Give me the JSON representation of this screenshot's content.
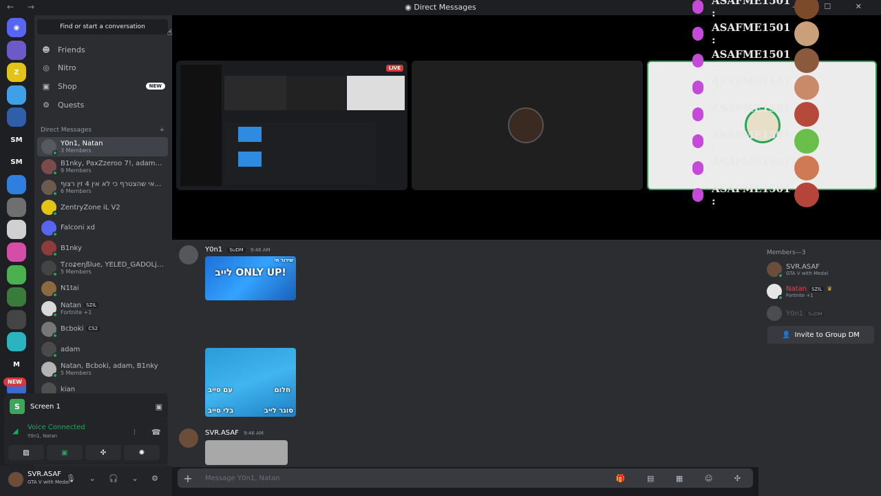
{
  "window": {
    "title": "Direct Messages",
    "nav": "← →",
    "controls": "— ☐ ✕"
  },
  "search": {
    "placeholder": "Find or start a conversation"
  },
  "nav_items": [
    {
      "label": "Friends",
      "icon": "friends-icon",
      "glyph": "☻"
    },
    {
      "label": "Nitro",
      "icon": "nitro-icon",
      "glyph": "◎"
    },
    {
      "label": "Shop",
      "icon": "shop-icon",
      "glyph": "▣",
      "badge": "NEW"
    },
    {
      "label": "Quests",
      "icon": "quests-icon",
      "glyph": "⚙"
    }
  ],
  "dm_header": {
    "label": "Direct Messages",
    "add": "+"
  },
  "dms": [
    {
      "name": "Y0n1, Natan",
      "sub": "3 Members",
      "selected": true,
      "color": "#56595f"
    },
    {
      "name": "B1nky, PaxZzeroo 7!, adam, Bcb...",
      "sub": "9 Members",
      "color": "#7a4b4b"
    },
    {
      "name": "וניתאי שהצטרף כי לא אין 4 זין רצוף",
      "sub": "6 Members",
      "color": "#6b5a4e"
    },
    {
      "name": "ZentryZone iL V2",
      "sub": "",
      "color": "#e3c416"
    },
    {
      "name": "Falconi xd",
      "sub": "",
      "color": "#5865f2"
    },
    {
      "name": "B1nky",
      "sub": "",
      "color": "#8e3b3b"
    },
    {
      "name": "Ƭɾօʑҽɳßlue, YELED_GADOLjr, it...",
      "sub": "5 Members",
      "color": "#444"
    },
    {
      "name": "N1tai",
      "sub": "",
      "color": "#8a6a3e"
    },
    {
      "name": "Natan",
      "sub": "Fortnite +1",
      "tag": "SZIL",
      "color": "#d9d9d9"
    },
    {
      "name": "Bcboki",
      "sub": "",
      "tag": "CS2",
      "color": "#777"
    },
    {
      "name": "adam",
      "sub": "",
      "color": "#4a4a4a"
    },
    {
      "name": "Natan, Bcboki, adam, B1nky",
      "sub": "5 Members",
      "color": "#b3b3b3"
    },
    {
      "name": "kian",
      "sub": "",
      "color": "#4f4f4f"
    }
  ],
  "servers": [
    {
      "label": "◉",
      "color": "#5865f2"
    },
    {
      "label": "",
      "color": "#6d5ac9"
    },
    {
      "label": "Z",
      "color": "#e3c416"
    },
    {
      "label": "",
      "color": "#3fa0e8"
    },
    {
      "label": "",
      "color": "#2f5fa8"
    },
    {
      "label": "SM",
      "color": "#1e1f22"
    },
    {
      "label": "SM",
      "color": "#1e1f22"
    },
    {
      "label": "",
      "color": "#2f7fe0"
    },
    {
      "label": "",
      "color": "#6f6f6f"
    },
    {
      "label": "",
      "color": "#d0d0d0"
    },
    {
      "label": "",
      "color": "#d44da8"
    },
    {
      "label": "",
      "color": "#4caf50"
    },
    {
      "label": "",
      "color": "#3a7a3a"
    },
    {
      "label": "",
      "color": "#444"
    },
    {
      "label": "",
      "color": "#2bb3c0"
    },
    {
      "label": "M",
      "color": "#1e1f22"
    },
    {
      "label": "",
      "color": "#3a6ad0"
    }
  ],
  "server_new_badge": "NEW",
  "screen_share": {
    "label": "Screen 1",
    "icon_letter": "S"
  },
  "voice": {
    "status": "Voice Connected",
    "channel": "Y0n1, Natan"
  },
  "voice_buttons": [
    "▨",
    "▣",
    "✣",
    "✺"
  ],
  "user": {
    "name": "SVR.ASAF",
    "status": "GTA V with Medal",
    "controls": "🎙 ⌄ 🎧 ⌄ ⚙"
  },
  "stage": {
    "live_label": "LIVE"
  },
  "overlay_name": "ASAFME1501 :",
  "overlay_colors": [
    "#7a4a2a",
    "#c9a07a",
    "#8b5a3c",
    "#c98a6a",
    "#b54a3a",
    "#6abf4b",
    "#d07a55",
    "#b5453a"
  ],
  "messages": [
    {
      "author": "Y0n1",
      "tag": "SuDM",
      "time": "9:46 AM"
    },
    {
      "author": "SVR.ASAF",
      "time": "9:46 AM"
    }
  ],
  "thumbs": {
    "t1_text": "לייב ONLY UP!",
    "t1_top": "שידור חי",
    "t2_labels": [
      "עם סייב",
      "חלום",
      "בלי סייב",
      "סוגר לייב"
    ]
  },
  "composer": {
    "placeholder": "Message Y0n1, Natan",
    "plus": "+",
    "icons": "🎁 ▤ ▦ ☺ ✣"
  },
  "members": {
    "header": "Members—3",
    "list": [
      {
        "name": "SVR.ASAF",
        "sub": "GTA V with Medal",
        "color": "#6b4d3a",
        "online": true
      },
      {
        "name": "Natan",
        "sub": "Fortnite +1",
        "tag": "SZIL",
        "crown": "♛",
        "color": "#e6e6e6",
        "online": true,
        "name_color": "#f23f43"
      },
      {
        "name": "Y0n1",
        "sub": "",
        "tag": "SuDM",
        "color": "#888",
        "online": false
      }
    ],
    "invite": "Invite to Group DM"
  }
}
